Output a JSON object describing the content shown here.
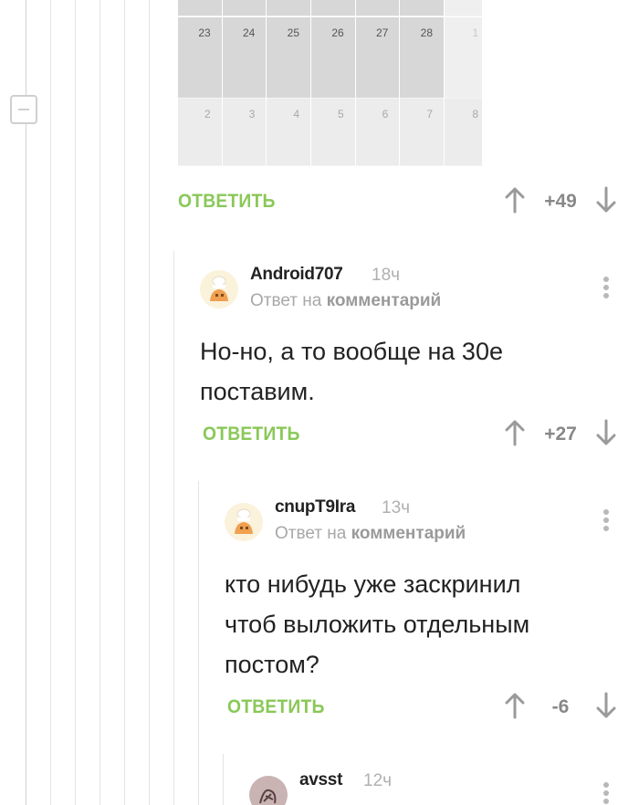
{
  "calendar": {
    "row1": [
      "23",
      "24",
      "25",
      "26",
      "27",
      "28",
      "1"
    ],
    "row2": [
      "2",
      "3",
      "4",
      "5",
      "6",
      "7",
      "8"
    ]
  },
  "comments": [
    {
      "reply_label": "ОТВЕТИТЬ",
      "rating": "+49"
    },
    {
      "username": "Android707",
      "time": "18ч",
      "reply_prefix": "Ответ на",
      "reply_link": "комментарий",
      "text_line1": "Но-но, а то вообще на 30е",
      "text_line2": "поставим.",
      "reply_label": "ОТВЕТИТЬ",
      "rating": "+27",
      "avatar_icon": "chef-cat-avatar"
    },
    {
      "username": "cnupT9Ira",
      "time": "13ч",
      "reply_prefix": "Ответ на",
      "reply_link": "комментарий",
      "text_line1": "кто нибудь уже заскринил",
      "text_line2": "чтоб выложить отдельным",
      "text_line3": "постом?",
      "reply_label": "ОТВЕТИТЬ",
      "rating": "-6",
      "avatar_icon": "chef-cat-avatar"
    },
    {
      "username": "avsst",
      "time": "12ч",
      "avatar_icon": "sketch-avatar"
    }
  ],
  "colors": {
    "reply_green": "#8ac858",
    "muted_gray": "#a8a8a8",
    "thread_line": "#e4e4e4"
  }
}
